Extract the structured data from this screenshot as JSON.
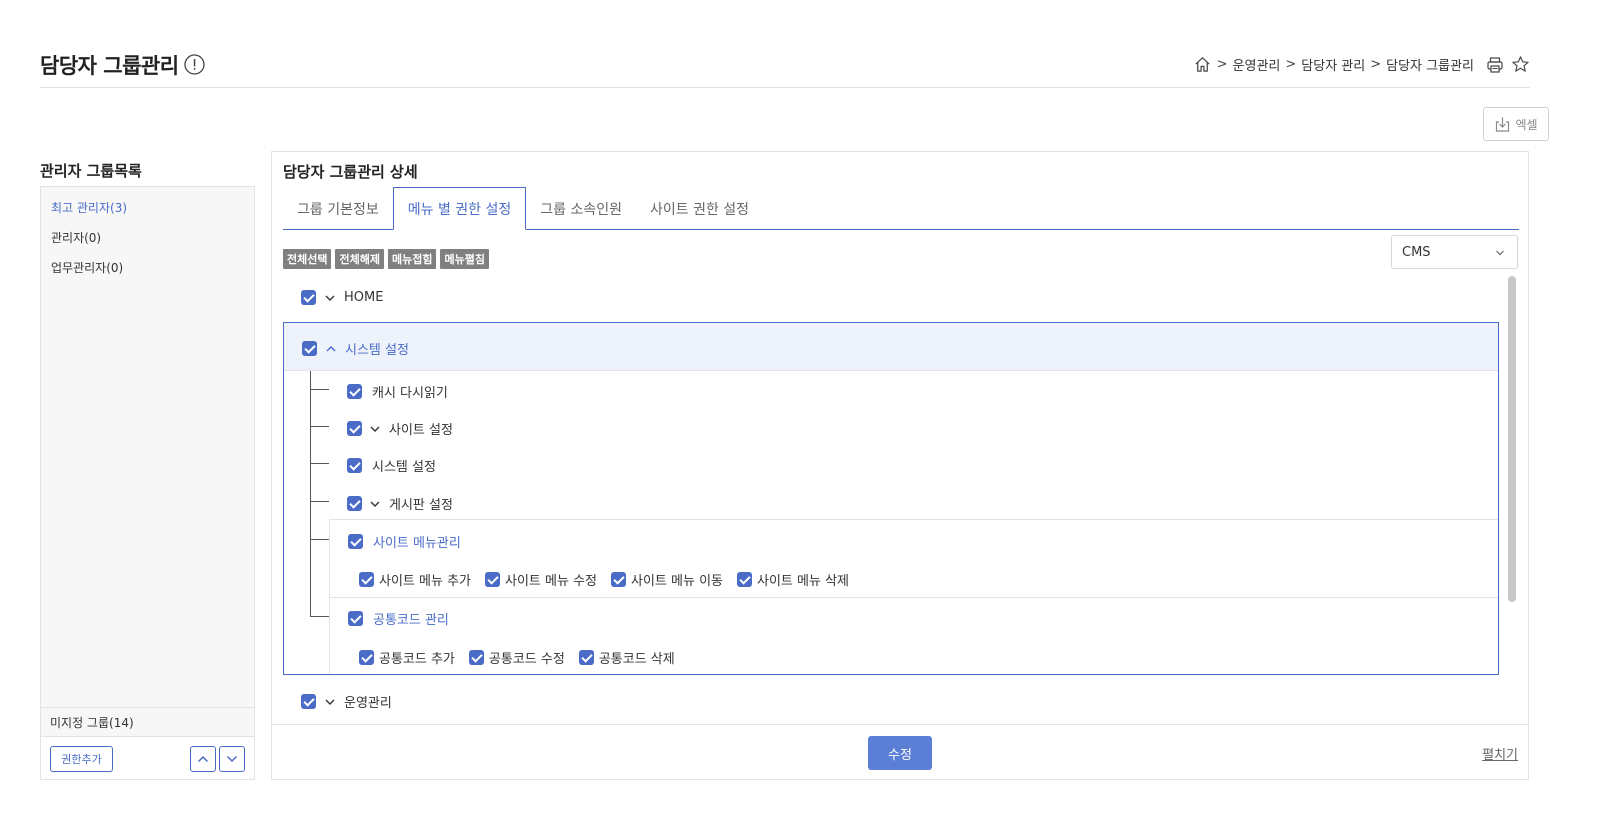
{
  "header": {
    "title": "담당자 그룹관리",
    "breadcrumb": [
      "운영관리",
      "담당자 관리",
      "담당자 그룹관리"
    ],
    "breadcrumb_sep": ">"
  },
  "toolbar": {
    "excel_label": "엑셀"
  },
  "left": {
    "title": "관리자 그룹목록",
    "groups": [
      {
        "label": "최고 관리자(3)",
        "active": true
      },
      {
        "label": "관리자(0)",
        "active": false
      },
      {
        "label": "업무관리자(0)",
        "active": false
      }
    ],
    "unassigned": "미지정 그룹(14)",
    "add_button": "권한추가"
  },
  "right": {
    "title": "담당자 그룹관리 상세",
    "tabs": [
      {
        "label": "그룹 기본정보",
        "active": false
      },
      {
        "label": "메뉴 별 권한 설정",
        "active": true
      },
      {
        "label": "그룹 소속인원",
        "active": false
      },
      {
        "label": "사이트 권한 설정",
        "active": false
      }
    ],
    "actions": [
      "전체선택",
      "전체해제",
      "메뉴접힘",
      "메뉴펼침"
    ],
    "site_select": "CMS",
    "tree": {
      "home": "HOME",
      "system": "시스템 설정",
      "children": [
        "캐시 다시읽기",
        "사이트 설정",
        "시스템 설정",
        "게시판 설정"
      ],
      "site_menu": {
        "label": "사이트 메뉴관리",
        "perms": [
          "사이트 메뉴 추가",
          "사이트 메뉴 수정",
          "사이트 메뉴 이동",
          "사이트 메뉴 삭제"
        ]
      },
      "common_code": {
        "label": "공통코드 관리",
        "perms": [
          "공통코드 추가",
          "공통코드 수정",
          "공통코드 삭제"
        ]
      },
      "operation": "운영관리"
    },
    "edit_button": "수정",
    "expand_link": "펼치기"
  },
  "colors": {
    "accent": "#4a6cc7",
    "button": "#5b7fd6",
    "action_gray": "#808080"
  }
}
